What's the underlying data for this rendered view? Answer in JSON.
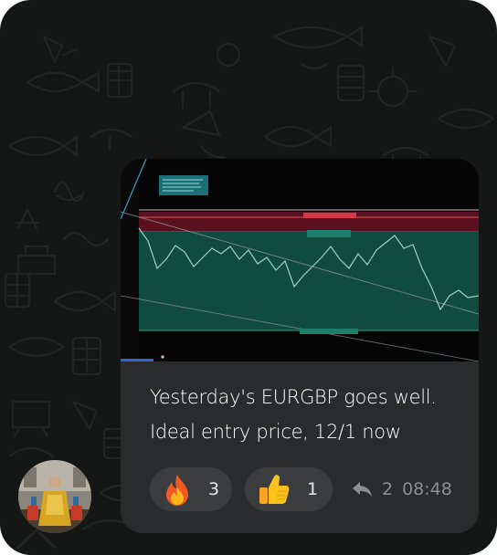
{
  "message": {
    "caption_lines": [
      "Yesterday's EURGBP goes well.",
      "Ideal entry price, 12/1 now"
    ],
    "reactions": [
      {
        "emoji": "fire-emoji",
        "count": "3"
      },
      {
        "emoji": "thumbs-up-emoji",
        "count": "1"
      }
    ],
    "reply_count": "2",
    "time": "08:48"
  },
  "colors": {
    "background": "#151616",
    "bubble": "#2a2b2c",
    "reaction_pill": "#3b3c3d",
    "chart_zone_green": "#0f4b3e",
    "chart_zone_red": "#5a1020",
    "meta_text": "#8d8e8f"
  }
}
